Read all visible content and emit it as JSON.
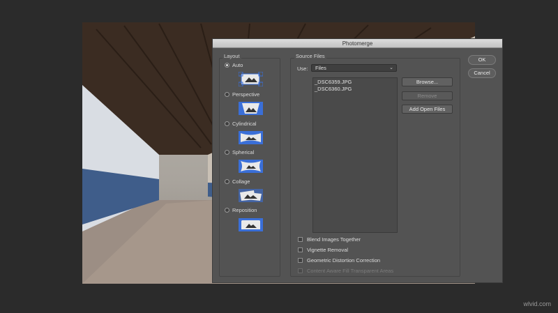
{
  "window": {
    "title": "Photomerge"
  },
  "layout": {
    "legend": "Layout",
    "options": [
      {
        "label": "Auto",
        "selected": true
      },
      {
        "label": "Perspective",
        "selected": false
      },
      {
        "label": "Cylindrical",
        "selected": false
      },
      {
        "label": "Spherical",
        "selected": false
      },
      {
        "label": "Collage",
        "selected": false
      },
      {
        "label": "Reposition",
        "selected": false
      }
    ]
  },
  "source": {
    "legend": "Source Files",
    "use_label": "Use:",
    "use_value": "Files",
    "files": [
      "_DSC6359.JPG",
      "_DSC6360.JPG"
    ],
    "browse_label": "Browse...",
    "remove_label": "Remove",
    "add_open_label": "Add Open Files",
    "options": [
      {
        "label": "Blend Images Together",
        "checked": false,
        "enabled": true
      },
      {
        "label": "Vignette Removal",
        "checked": false,
        "enabled": true
      },
      {
        "label": "Geometric Distortion Correction",
        "checked": false,
        "enabled": true
      },
      {
        "label": "Content Aware Fill Transparent Areas",
        "checked": false,
        "enabled": false
      }
    ]
  },
  "actions": {
    "ok_label": "OK",
    "cancel_label": "Cancel"
  },
  "watermark": "wlvid.com",
  "colors": {
    "thumb_blue": "#3a6fd8",
    "dialog_bg": "#535353"
  }
}
